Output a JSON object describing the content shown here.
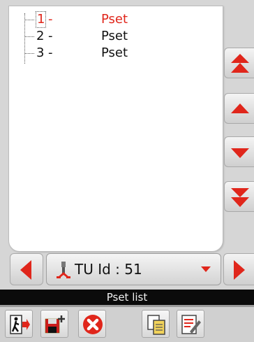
{
  "pset_list": {
    "items": [
      {
        "number": "1",
        "dash": "-",
        "name": "Pset",
        "selected": true
      },
      {
        "number": "2",
        "dash": "-",
        "name": "Pset",
        "selected": false
      },
      {
        "number": "3",
        "dash": "-",
        "name": "Pset",
        "selected": false
      }
    ]
  },
  "scroll_buttons": [
    "scroll-to-top",
    "scroll-up",
    "scroll-down",
    "scroll-to-bottom"
  ],
  "tu_selector": {
    "label": "TU Id : 51"
  },
  "status_bar": {
    "title": "Pset list"
  },
  "toolbar": {
    "icons": [
      "exit-icon",
      "save-new-icon",
      "delete-icon",
      "copy-icon",
      "edit-icon"
    ]
  },
  "colors": {
    "accent_red": "#e0261b",
    "selected_text": "#e0261b",
    "status_bar_bg": "#0b0b0b"
  }
}
